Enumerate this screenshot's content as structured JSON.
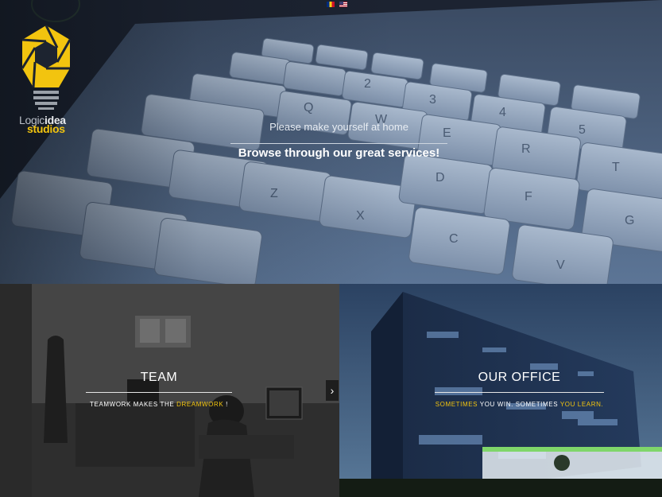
{
  "brand": {
    "logo_word1_a": "Logic",
    "logo_word1_b": "idea",
    "logo_word2": "studios",
    "accent_color": "#f2c40f"
  },
  "languages": [
    {
      "code": "ro",
      "icon": "romanian-flag-icon"
    },
    {
      "code": "en",
      "icon": "us-flag-icon"
    }
  ],
  "hero": {
    "tagline": "Please make yourself at home",
    "headline": "Browse through our great services!"
  },
  "panels": {
    "team": {
      "title": "TEAM",
      "subtitle_pre": "TEAMWORK MAKES THE ",
      "subtitle_highlight": "DREAMWORK",
      "subtitle_post": " !"
    },
    "office": {
      "title": "OUR OFFICE",
      "subtitle_hl1": "SOMETIMES",
      "subtitle_mid": " YOU WIN. SOMETIMES ",
      "subtitle_hl2": "YOU LEARN."
    }
  },
  "controls": {
    "next_arrow": "›",
    "next_icon": "chevron-right-icon"
  }
}
